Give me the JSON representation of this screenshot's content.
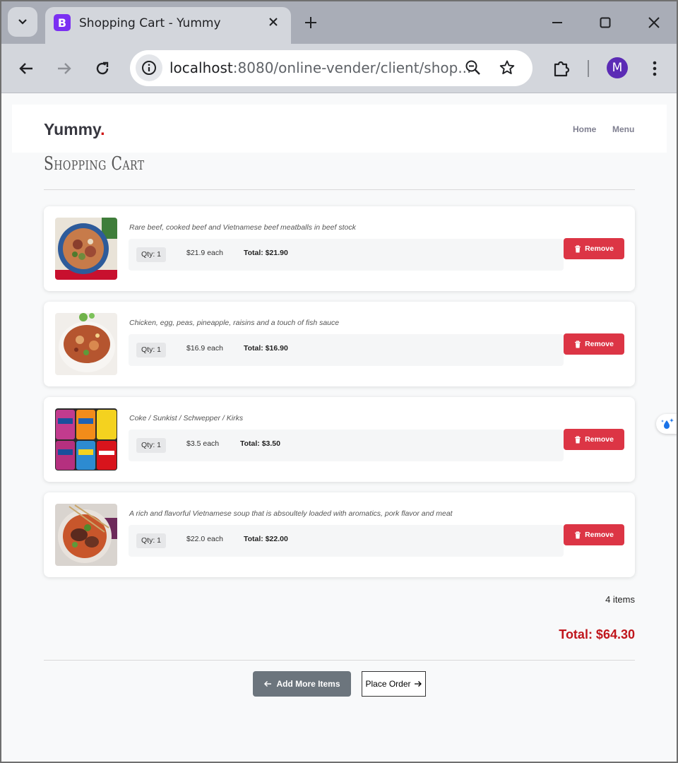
{
  "browser": {
    "tab_title": "Shopping Cart - Yummy",
    "favicon_letter": "B",
    "url_host": "localhost",
    "url_rest": ":8080/online-vender/client/shop...",
    "profile_initial": "M"
  },
  "site": {
    "logo_text": "Yummy",
    "logo_dot": ".",
    "nav": [
      {
        "label": "Home"
      },
      {
        "label": "Menu"
      }
    ]
  },
  "cart": {
    "title": "Shopping Cart",
    "items": [
      {
        "image": "pho-bowl-image",
        "description": "Rare beef, cooked beef and Vietnamese beef meatballs in beef stock",
        "qty": "Qty: 1",
        "each": "$21.9 each",
        "total": "Total: $21.90",
        "remove_label": "Remove"
      },
      {
        "image": "fried-rice-bowl-image",
        "description": "Chicken, egg, peas, pineapple, raisins and a touch of fish sauce",
        "qty": "Qty: 1",
        "each": "$16.9 each",
        "total": "Total: $16.90",
        "remove_label": "Remove"
      },
      {
        "image": "soft-drink-cans-image",
        "description": "Coke / Sunkist / Schwepper / Kirks",
        "qty": "Qty: 1",
        "each": "$3.5 each",
        "total": "Total: $3.50",
        "remove_label": "Remove"
      },
      {
        "image": "beef-noodle-soup-image",
        "description": "A rich and flavorful Vietnamese soup that is absoultely loaded with aromatics, pork flavor and meat",
        "qty": "Qty: 1",
        "each": "$22.0 each",
        "total": "Total: $22.00",
        "remove_label": "Remove"
      }
    ],
    "items_count": "4 items",
    "grand_total": "Total: $64.30",
    "add_more_label": "Add More Items",
    "place_order_label": "Place Order"
  },
  "colors": {
    "accent_red": "#ce1212",
    "remove_red": "#dc3545",
    "secondary_gray": "#6c757d",
    "total_red": "#c0161c"
  }
}
